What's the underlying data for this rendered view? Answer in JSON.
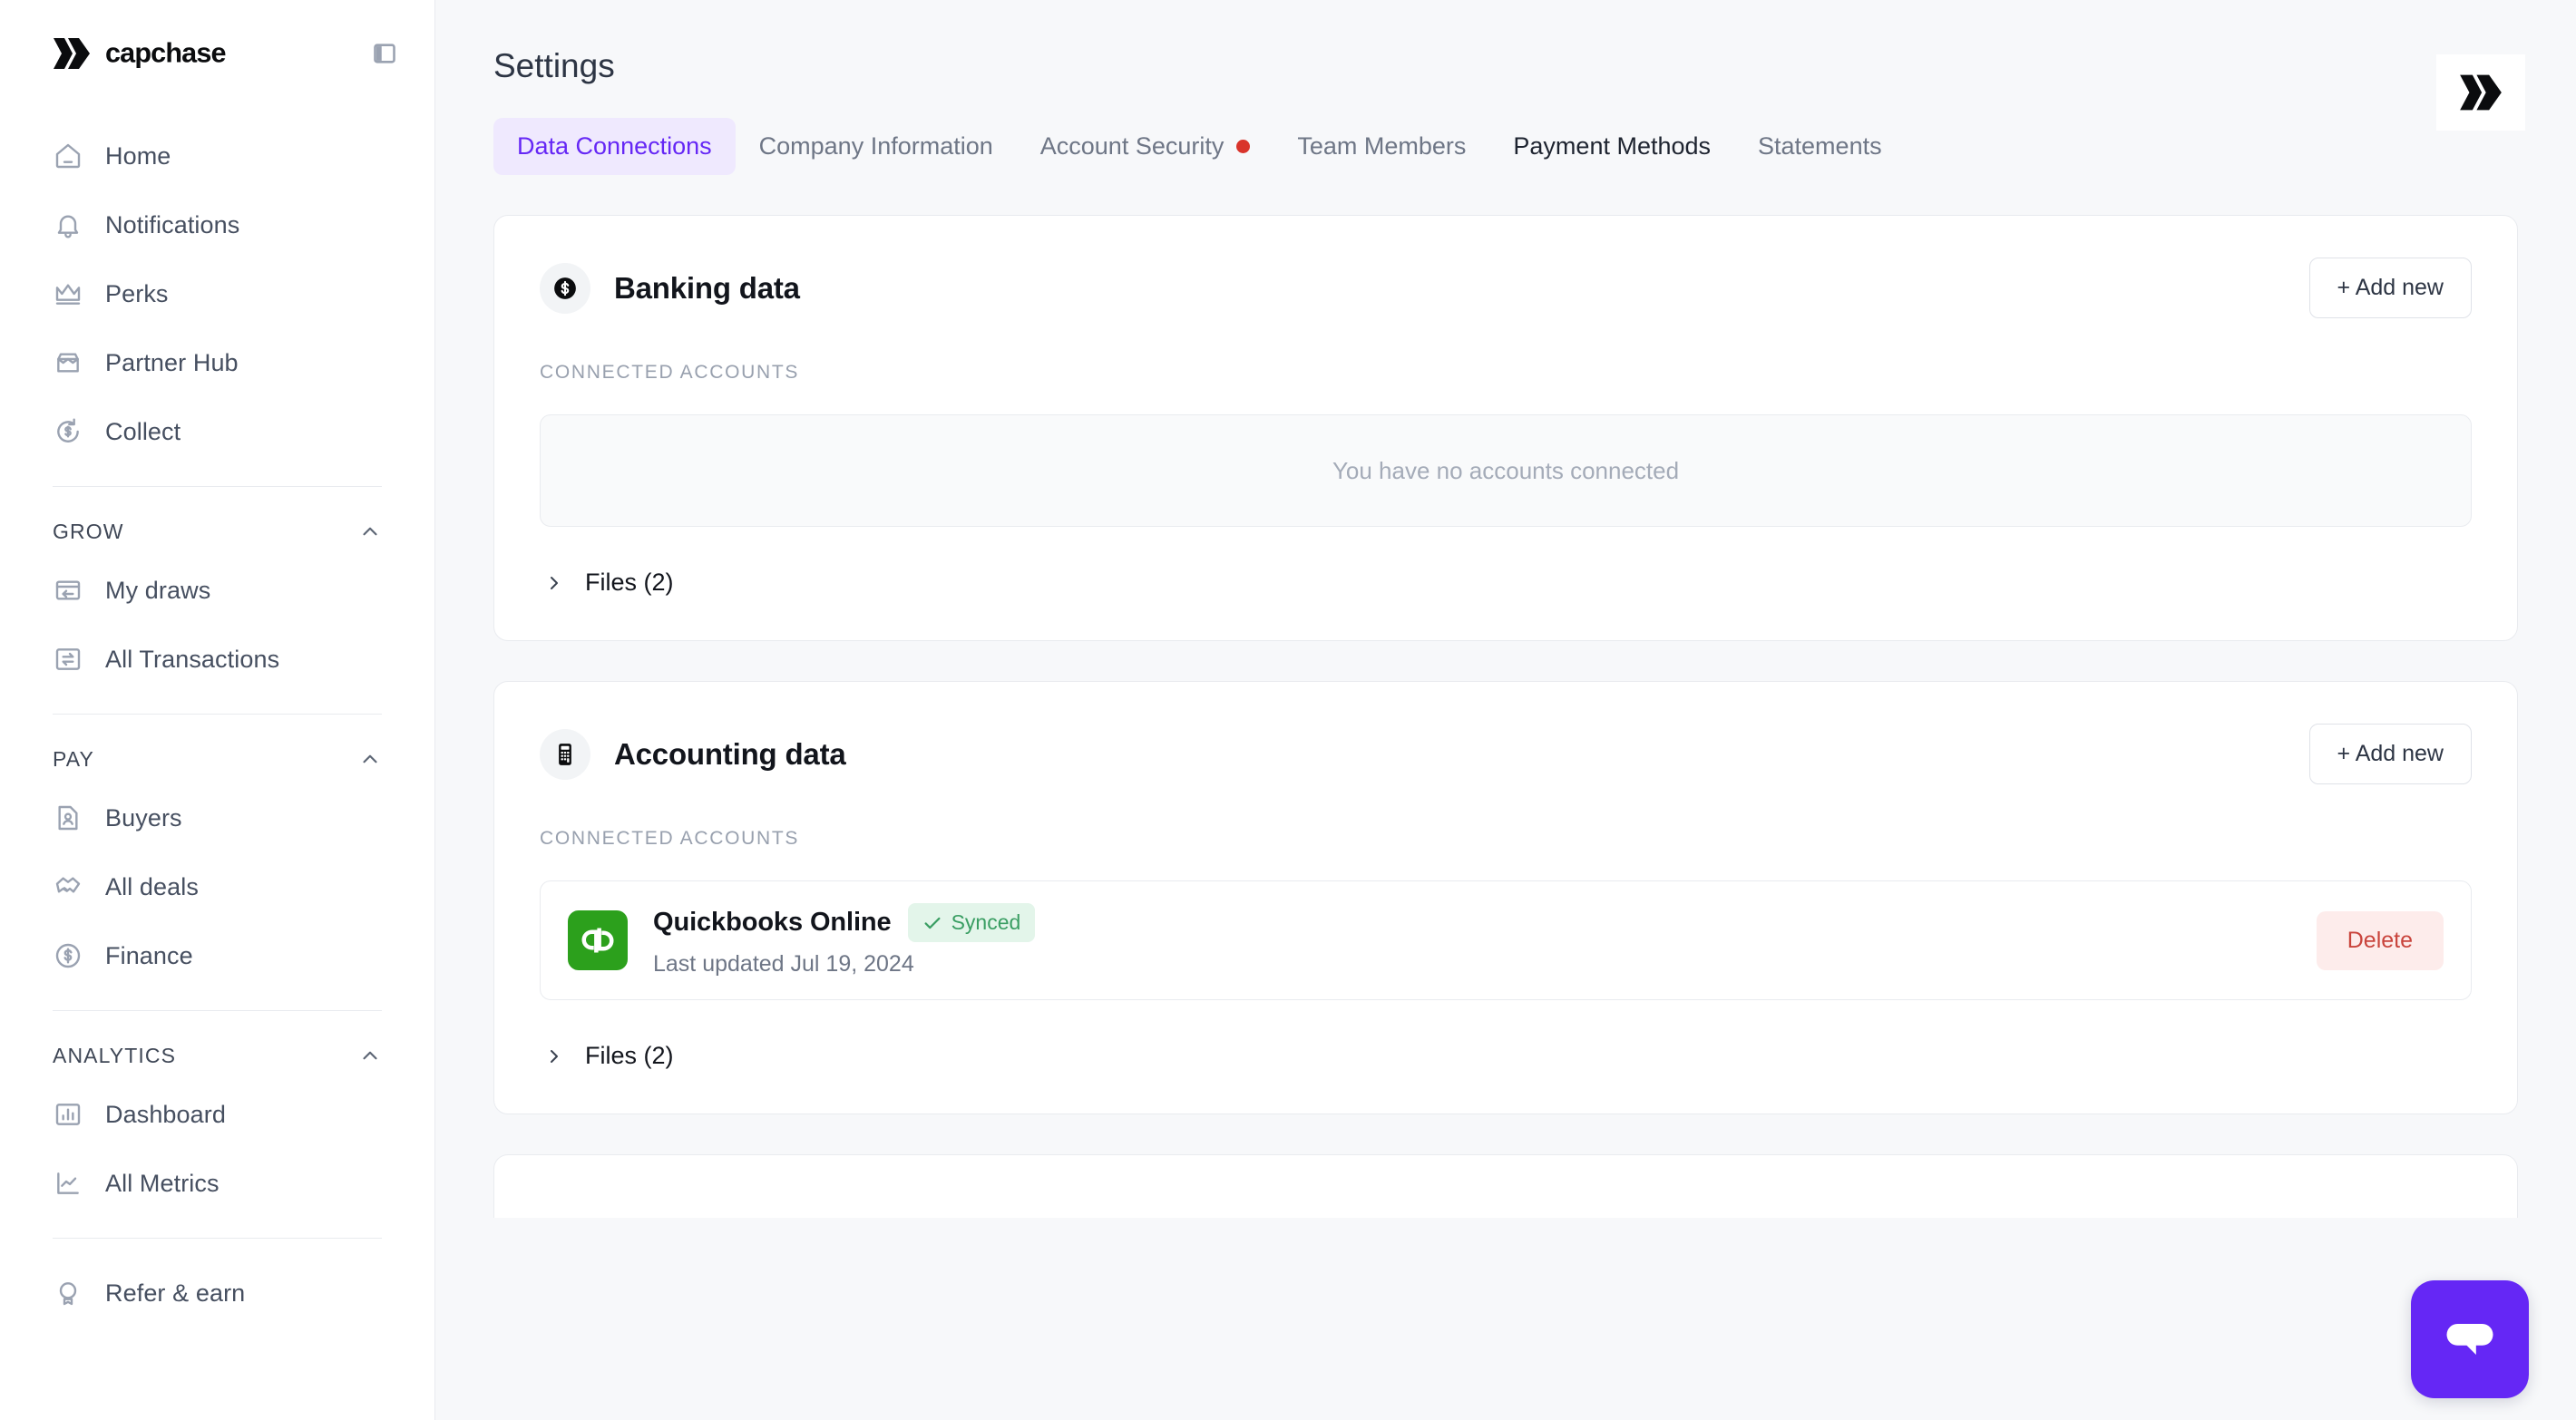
{
  "brand": {
    "name": "capchase",
    "collapse_icon": "panel-collapse-icon"
  },
  "sidebar": {
    "top_items": [
      {
        "label": "Home",
        "icon": "home-icon"
      },
      {
        "label": "Notifications",
        "icon": "bell-icon"
      },
      {
        "label": "Perks",
        "icon": "crown-icon"
      },
      {
        "label": "Partner Hub",
        "icon": "storefront-icon"
      },
      {
        "label": "Collect",
        "icon": "dollar-refresh-icon"
      }
    ],
    "groups": [
      {
        "title": "GROW",
        "chevron": "chevron-up-icon",
        "items": [
          {
            "label": "My draws",
            "icon": "draw-card-icon"
          },
          {
            "label": "All Transactions",
            "icon": "transactions-icon"
          }
        ]
      },
      {
        "title": "PAY",
        "chevron": "chevron-up-icon",
        "items": [
          {
            "label": "Buyers",
            "icon": "contact-document-icon"
          },
          {
            "label": "All deals",
            "icon": "handshake-icon"
          },
          {
            "label": "Finance",
            "icon": "dollar-circle-icon"
          }
        ]
      },
      {
        "title": "ANALYTICS",
        "chevron": "chevron-up-icon",
        "items": [
          {
            "label": "Dashboard",
            "icon": "bar-chart-icon"
          },
          {
            "label": "All Metrics",
            "icon": "line-chart-icon"
          }
        ]
      }
    ],
    "footer_items": [
      {
        "label": "Refer & earn",
        "icon": "referral-badge-icon"
      }
    ]
  },
  "header": {
    "title": "Settings"
  },
  "tabs": [
    {
      "label": "Data Connections",
      "state": "active"
    },
    {
      "label": "Company Information",
      "state": "default"
    },
    {
      "label": "Account Security",
      "state": "default",
      "dot": true
    },
    {
      "label": "Team Members",
      "state": "default"
    },
    {
      "label": "Payment Methods",
      "state": "hovered"
    },
    {
      "label": "Statements",
      "state": "default"
    }
  ],
  "cards": {
    "banking": {
      "title": "Banking data",
      "icon": "dollar-coin-icon",
      "add_label": "+ Add new",
      "section_label": "CONNECTED ACCOUNTS",
      "empty_text": "You have no accounts connected",
      "files_label": "Files (2)"
    },
    "accounting": {
      "title": "Accounting data",
      "icon": "calculator-icon",
      "add_label": "+ Add new",
      "section_label": "CONNECTED ACCOUNTS",
      "account": {
        "name": "Quickbooks Online",
        "logo": "quickbooks-icon",
        "status": "Synced",
        "status_icon": "check-icon",
        "last_updated": "Last updated Jul 19, 2024",
        "delete_label": "Delete"
      },
      "files_label": "Files (2)"
    }
  },
  "chat": {
    "icon": "chat-bubble-icon"
  },
  "logo_badge": {
    "icon": "capchase-mark-icon"
  },
  "colors": {
    "accent_purple": "#6527f5",
    "tab_active_bg": "#efe9fe",
    "status_green_text": "#3a9e63",
    "status_green_bg": "#e3f5ea",
    "delete_red_text": "#c9443c",
    "delete_red_bg": "#fdeceb",
    "alert_dot_red": "#d9342b",
    "quickbooks_green": "#2ca01c",
    "page_bg": "#f7f8fa"
  }
}
